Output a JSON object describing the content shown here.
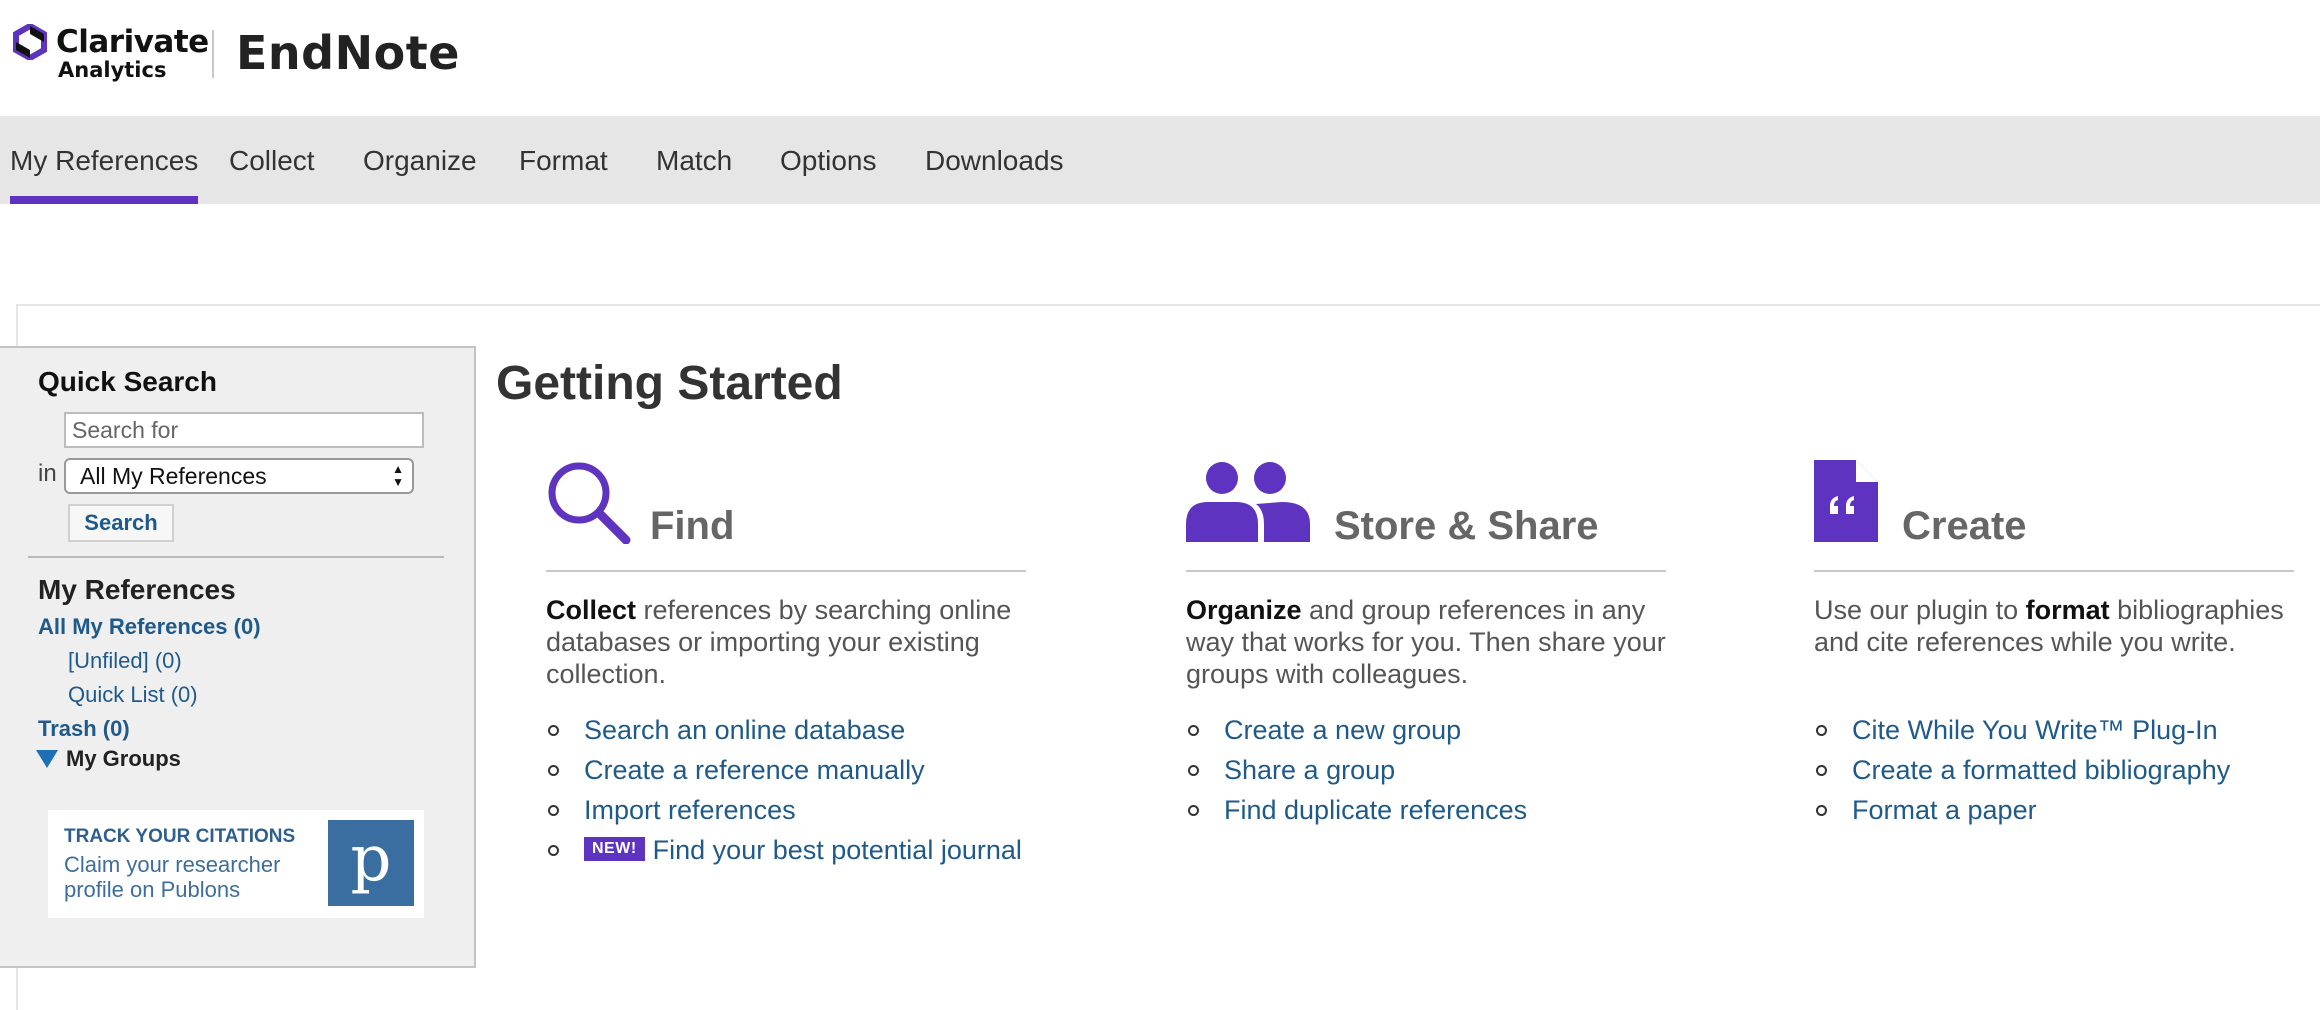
{
  "brand": {
    "company_line1": "Clarivate",
    "company_line2": "Analytics",
    "product": "EndNote"
  },
  "nav": {
    "items": [
      "My References",
      "Collect",
      "Organize",
      "Format",
      "Match",
      "Options",
      "Downloads"
    ],
    "active": "My References",
    "accent_color": "#5e33bf"
  },
  "sidebar": {
    "quick_search_title": "Quick Search",
    "search_placeholder": "Search for",
    "in_label": "in",
    "scope_selected": "All My References",
    "search_button": "Search",
    "my_references_title": "My References",
    "links": {
      "all": "All My References (0)",
      "unfiled": "[Unfiled] (0)",
      "quick_list": "Quick List (0)",
      "trash": "Trash (0)"
    },
    "my_groups": "My Groups",
    "publons": {
      "line1": "TRACK YOUR CITATIONS",
      "line2": "Claim your researcher profile on Publons",
      "logo_letter": "p"
    }
  },
  "main": {
    "title": "Getting Started",
    "columns": [
      {
        "heading": "Find",
        "icon": "magnifier-icon",
        "desc_bold": "Collect",
        "desc_rest": " references by searching online databases or importing your existing collection.",
        "links": [
          "Search an online database",
          "Create a reference manually",
          "Import references"
        ],
        "badge": "NEW!",
        "badge_link": "Find your best potential journal"
      },
      {
        "heading": "Store & Share",
        "icon": "people-icon",
        "desc_bold": "Organize",
        "desc_rest": " and group references in any way that works for you. Then share your groups with colleagues.",
        "links": [
          "Create a new group",
          "Share a group",
          "Find duplicate references"
        ]
      },
      {
        "heading": "Create",
        "icon": "document-quote-icon",
        "desc_pre": "Use our plugin to ",
        "desc_bold": "format",
        "desc_rest": " bibliographies and cite references while you write.",
        "links": [
          "Cite While You Write™ Plug-In",
          "Create a formatted bibliography",
          "Format a paper"
        ]
      }
    ]
  }
}
